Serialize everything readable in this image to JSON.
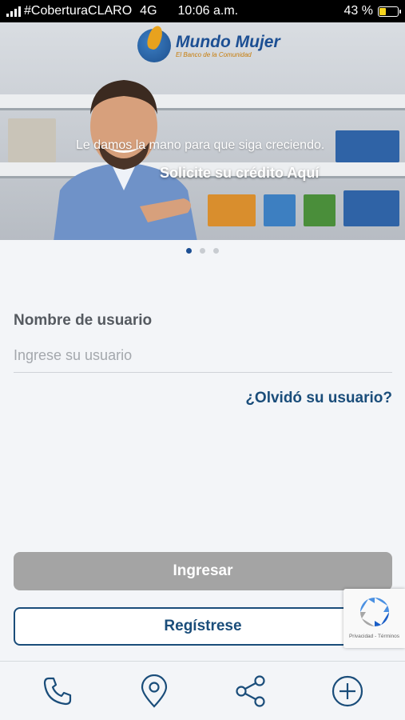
{
  "status_bar": {
    "carrier": "#CoberturaCLARO",
    "network": "4G",
    "time": "10:06 a.m.",
    "battery_percent": "43 %",
    "battery_level": 0.43,
    "battery_color": "#f7d51d"
  },
  "banner": {
    "logo_title": "Mundo Mujer",
    "logo_tagline": "El Banco de la Comunidad",
    "line1": "Le damos la mano para que siga creciendo.",
    "line2": "Solicite su crédito Aquí",
    "slide_count": 3,
    "active_slide": 1
  },
  "form": {
    "username_label": "Nombre de usuario",
    "username_placeholder": "Ingrese su usuario",
    "username_value": "",
    "forgot_link": "¿Olvidó su usuario?"
  },
  "buttons": {
    "login_label": "Ingresar",
    "register_label": "Regístrese"
  },
  "recaptcha": {
    "links": "Privacidad - Términos"
  },
  "bottom_nav": {
    "items": [
      "phone-icon",
      "location-pin-icon",
      "share-icon",
      "add-circle-icon"
    ]
  },
  "colors": {
    "brand_blue": "#1a4d7a",
    "login_disabled": "#a4a4a4",
    "logo_orange": "#e8a21e"
  }
}
